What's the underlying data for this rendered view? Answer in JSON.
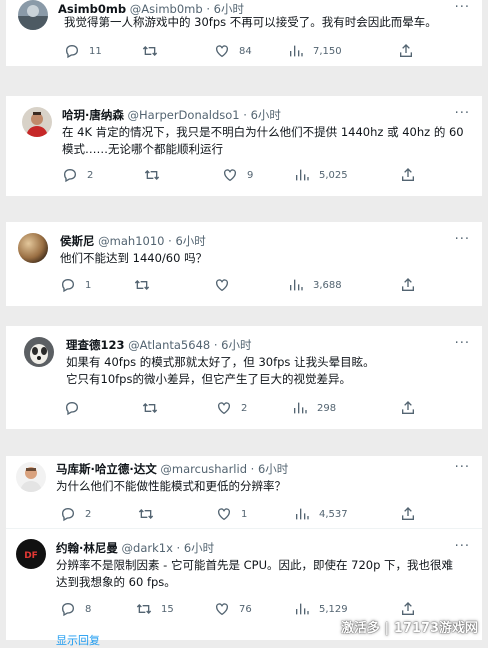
{
  "tweets": [
    {
      "name": "Asimb0mb",
      "handle": "@Asimb0mb",
      "time": "6小时",
      "lines": [
        "我觉得第一人称游戏中的 30fps 不再可以接受了。我有时会因此而晕车。"
      ],
      "replies": "11",
      "retweets": "",
      "likes": "84",
      "views": "7,150"
    },
    {
      "name": "哈玥·唐纳森",
      "handle": "@HarperDonaldso1",
      "time": "6小时",
      "lines": [
        "在 4K 肯定的情况下，我只是不明白为什么他们不提供 1440hz 或 40hz 的 60",
        "模式……无论哪个都能顺利运行"
      ],
      "replies": "2",
      "retweets": "",
      "likes": "9",
      "views": "5,025"
    },
    {
      "name": "侯斯尼",
      "handle": "@mah1010",
      "time": "6小时",
      "lines": [
        "他们不能达到 1440/60 吗？"
      ],
      "replies": "1",
      "retweets": "",
      "likes": "",
      "views": "3,688"
    },
    {
      "name": "理查德123",
      "handle": "@Atlanta5648",
      "time": "6小时",
      "lines": [
        "如果有 40fps 的模式那就太好了，但 30fps 让我头晕目眩。",
        "它只有10fps的微小差异，但它产生了巨大的视觉差异。"
      ],
      "replies": "",
      "retweets": "",
      "likes": "2",
      "views": "298"
    },
    {
      "name": "马库斯·哈立德·达文",
      "handle": "@marcusharlid",
      "time": "6小时",
      "lines": [
        "为什么他们不能做性能模式和更低的分辨率？"
      ],
      "replies": "2",
      "retweets": "",
      "likes": "1",
      "views": "4,537"
    },
    {
      "name": "约翰·林尼曼",
      "handle": "@dark1x",
      "time": "6小时",
      "lines": [
        "分辨率不是限制因素 - 它可能首先是 CPU。因此，即使在 720p 下，我也很难",
        "达到我想象的 60 fps。"
      ],
      "replies": "8",
      "retweets": "15",
      "likes": "76",
      "views": "5,129"
    }
  ],
  "show_reply": "显示回复",
  "watermark": "激活多 | 17173游戏网",
  "colors": {
    "muted": "#536471",
    "text": "#0f1419",
    "link": "#1d9bf0",
    "bg": "#ececec"
  },
  "icons": [
    "reply-icon",
    "retweet-icon",
    "like-icon",
    "views-icon",
    "share-icon",
    "more-icon"
  ]
}
